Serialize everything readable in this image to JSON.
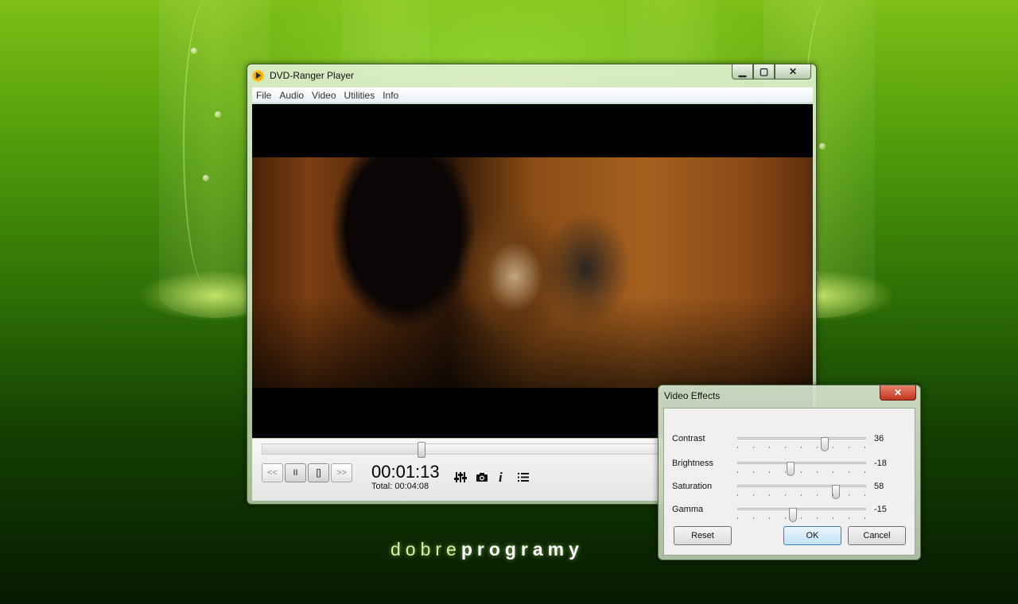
{
  "background": {
    "brand_light": "dobre",
    "brand_bold": "programy",
    "accent": "#6fb90f"
  },
  "window": {
    "title": "DVD-Ranger Player",
    "icon": "dvd-ranger-play-icon",
    "minimize_label": "▁",
    "maximize_label": "▢",
    "close_label": "✕"
  },
  "menu": {
    "items": [
      "File",
      "Audio",
      "Video",
      "Utilities",
      "Info"
    ]
  },
  "video": {
    "description_icon": "video-frame"
  },
  "controls": {
    "position": 0.29,
    "rewind_label": "<<",
    "pause_label": "II",
    "stop_label": "[]",
    "forward_label": ">>",
    "current_time": "00:01:13",
    "total_time": "Total: 00:04:08",
    "tools": {
      "equalizer_icon": "equalizer-icon",
      "snapshot_icon": "camera-icon",
      "info_icon": "info-icon",
      "playlist_icon": "playlist-icon"
    }
  },
  "effects_dialog": {
    "title": "Video Effects",
    "close_label": "✕",
    "sliders": [
      {
        "label": "Contrast",
        "value": "36",
        "level": 0.68
      },
      {
        "label": "Brightness",
        "value": "-18",
        "level": 0.41
      },
      {
        "label": "Saturation",
        "value": "58",
        "level": 0.77
      },
      {
        "label": "Gamma",
        "value": "-15",
        "level": 0.43
      }
    ],
    "reset_label": "Reset",
    "ok_label": "OK",
    "cancel_label": "Cancel"
  }
}
